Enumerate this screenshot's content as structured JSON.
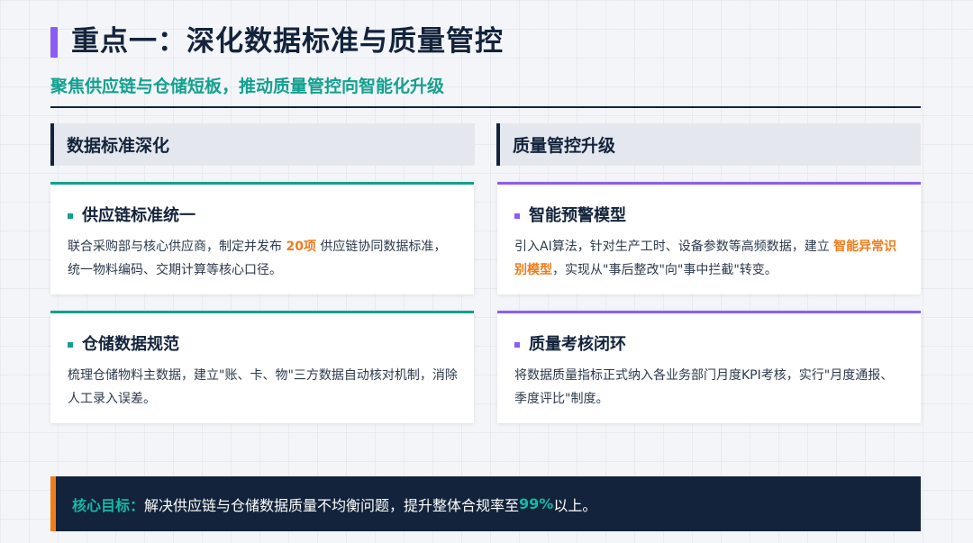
{
  "header": {
    "title": "重点一：深化数据标准与质量管控",
    "subtitle": "聚焦供应链与仓储短板，推动质量管控向智能化升级"
  },
  "left_column": {
    "heading": "数据标准深化",
    "cards": [
      {
        "title": "供应链标准统一",
        "body_before": "联合采购部与核心供应商，制定并发布 ",
        "highlight": "20项",
        "body_after": " 供应链协同数据标准，统一物料编码、交期计算等核心口径。"
      },
      {
        "title": "仓储数据规范",
        "body": "梳理仓储物料主数据，建立\"账、卡、物\"三方数据自动核对机制，消除人工录入误差。"
      }
    ]
  },
  "right_column": {
    "heading": "质量管控升级",
    "cards": [
      {
        "title": "智能预警模型",
        "body_before": "引入AI算法，针对生产工时、设备参数等高频数据，建立 ",
        "highlight": "智能异常识别模型",
        "body_after": "，实现从\"事后整改\"向\"事中拦截\"转变。"
      },
      {
        "title": "质量考核闭环",
        "body": "将数据质量指标正式纳入各业务部门月度KPI考核，实行\"月度通报、季度评比\"制度。"
      }
    ]
  },
  "footer": {
    "label": "核心目标：",
    "text_before": "解决供应链与仓储数据质量不均衡问题，提升整体合规率至 ",
    "value": "99%",
    "text_after": " 以上。"
  },
  "colors": {
    "accent_purple": "#8b5cf6",
    "accent_teal": "#14a08f",
    "highlight_orange": "#f07c1a",
    "navy": "#13233b"
  }
}
